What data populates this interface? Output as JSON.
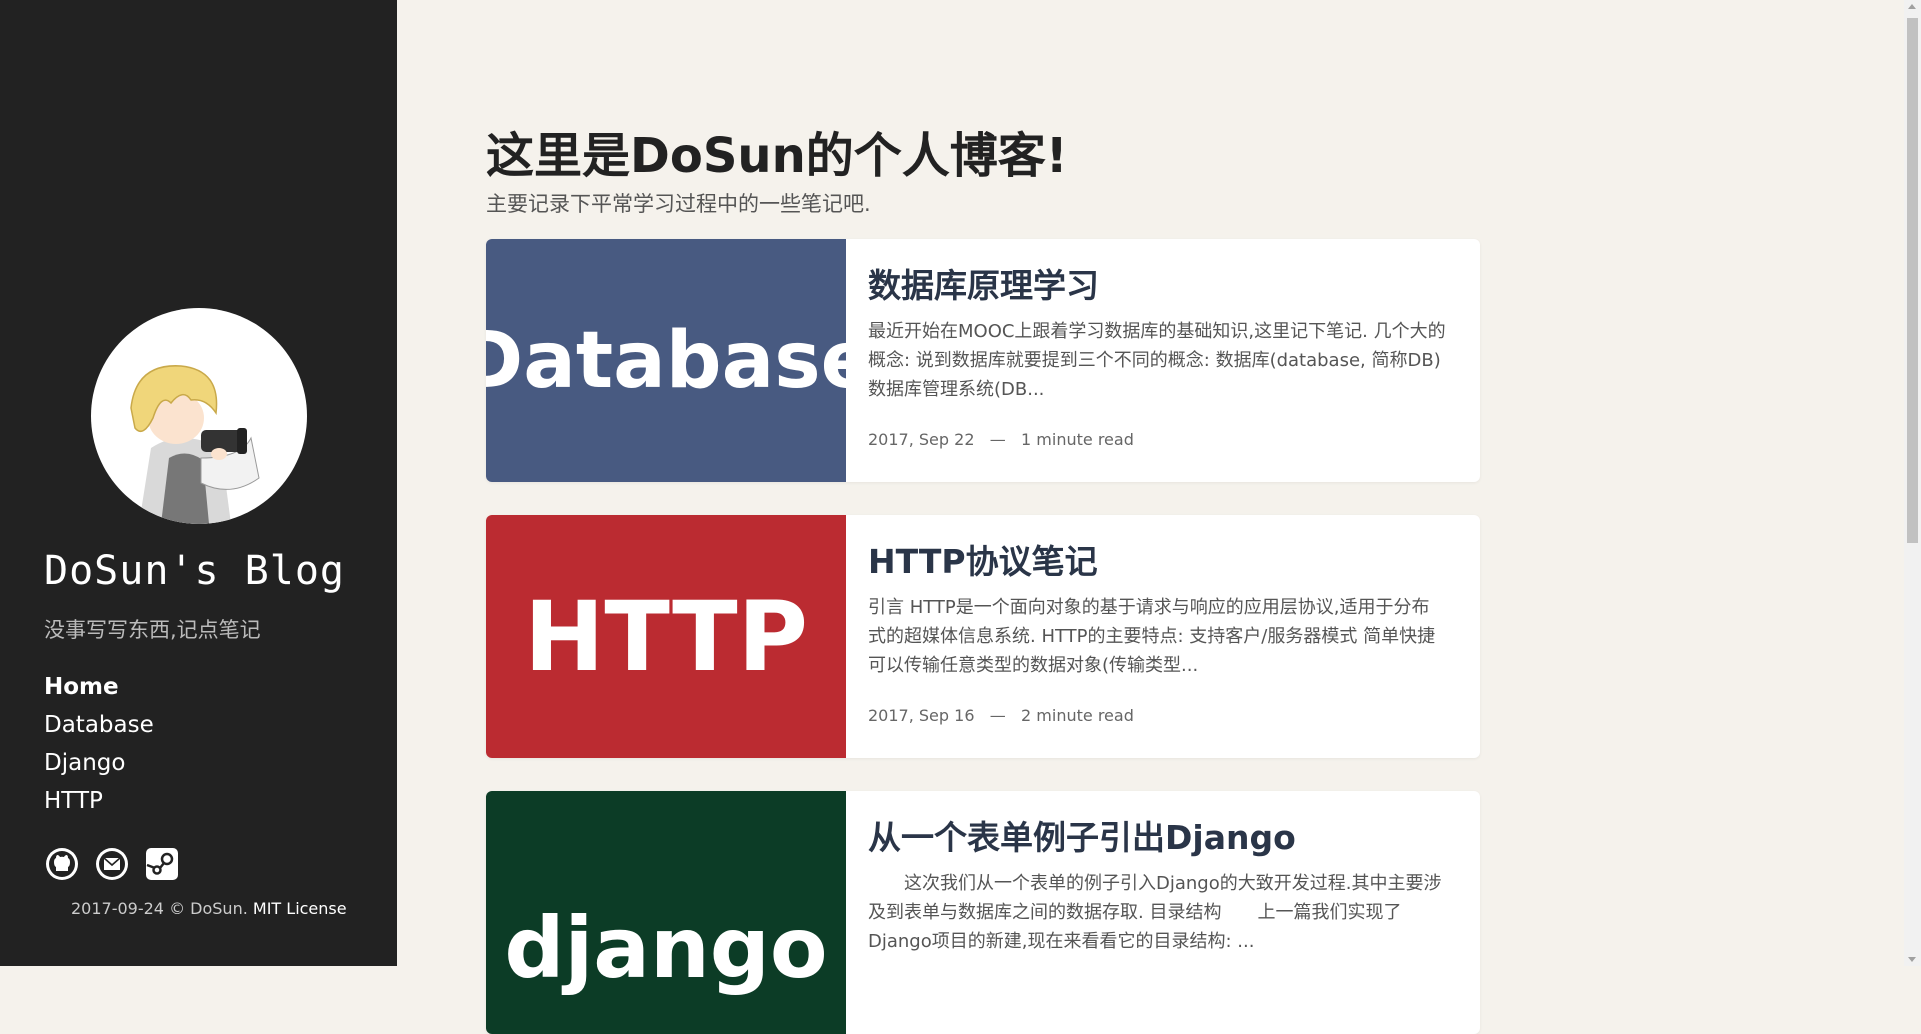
{
  "sidebar": {
    "title": "DoSun's Blog",
    "description": "没事写写东西,记点笔记",
    "nav": [
      {
        "label": "Home",
        "active": true
      },
      {
        "label": "Database",
        "active": false
      },
      {
        "label": "Django",
        "active": false
      },
      {
        "label": "HTTP",
        "active": false
      }
    ],
    "social_icons": [
      "github-icon",
      "mail-icon",
      "steam-icon"
    ],
    "footer_prefix": "2017-09-24 © DoSun.",
    "footer_license": "MIT License"
  },
  "main": {
    "title": "这里是DoSun的个人博客!",
    "subtitle": "主要记录下平常学习过程中的一些笔记吧.",
    "posts": [
      {
        "image_text": "Database",
        "image_color": "#485a81",
        "title": "数据库原理学习",
        "excerpt": "最近开始在MOOC上跟着学习数据库的基础知识,这里记下笔记. 几个大的概念: 说到数据库就要提到三个不同的概念: 数据库(database, 简称DB) 数据库管理系统(DB...",
        "date": "2017, Sep 22",
        "read_time": "1 minute read"
      },
      {
        "image_text": "HTTP",
        "image_color": "#bb2b31",
        "title": "HTTP协议笔记",
        "excerpt": "引言 HTTP是一个面向对象的基于请求与响应的应用层协议,适用于分布式的超媒体信息系统. HTTP的主要特点: 支持客户/服务器模式 简单快捷 可以传输任意类型的数据对象(传输类型...",
        "date": "2017, Sep 16",
        "read_time": "2 minute read"
      },
      {
        "image_text": "django",
        "image_color": "#0c3c26",
        "title": "从一个表单例子引出Django",
        "excerpt": "　　这次我们从一个表单的例子引入Django的大致开发过程.其中主要涉及到表单与数据库之间的数据存取. 目录结构　　上一篇我们实现了Django项目的新建,现在来看看它的目录结构: ...",
        "date": "",
        "read_time": ""
      }
    ],
    "meta_separator": "—"
  }
}
